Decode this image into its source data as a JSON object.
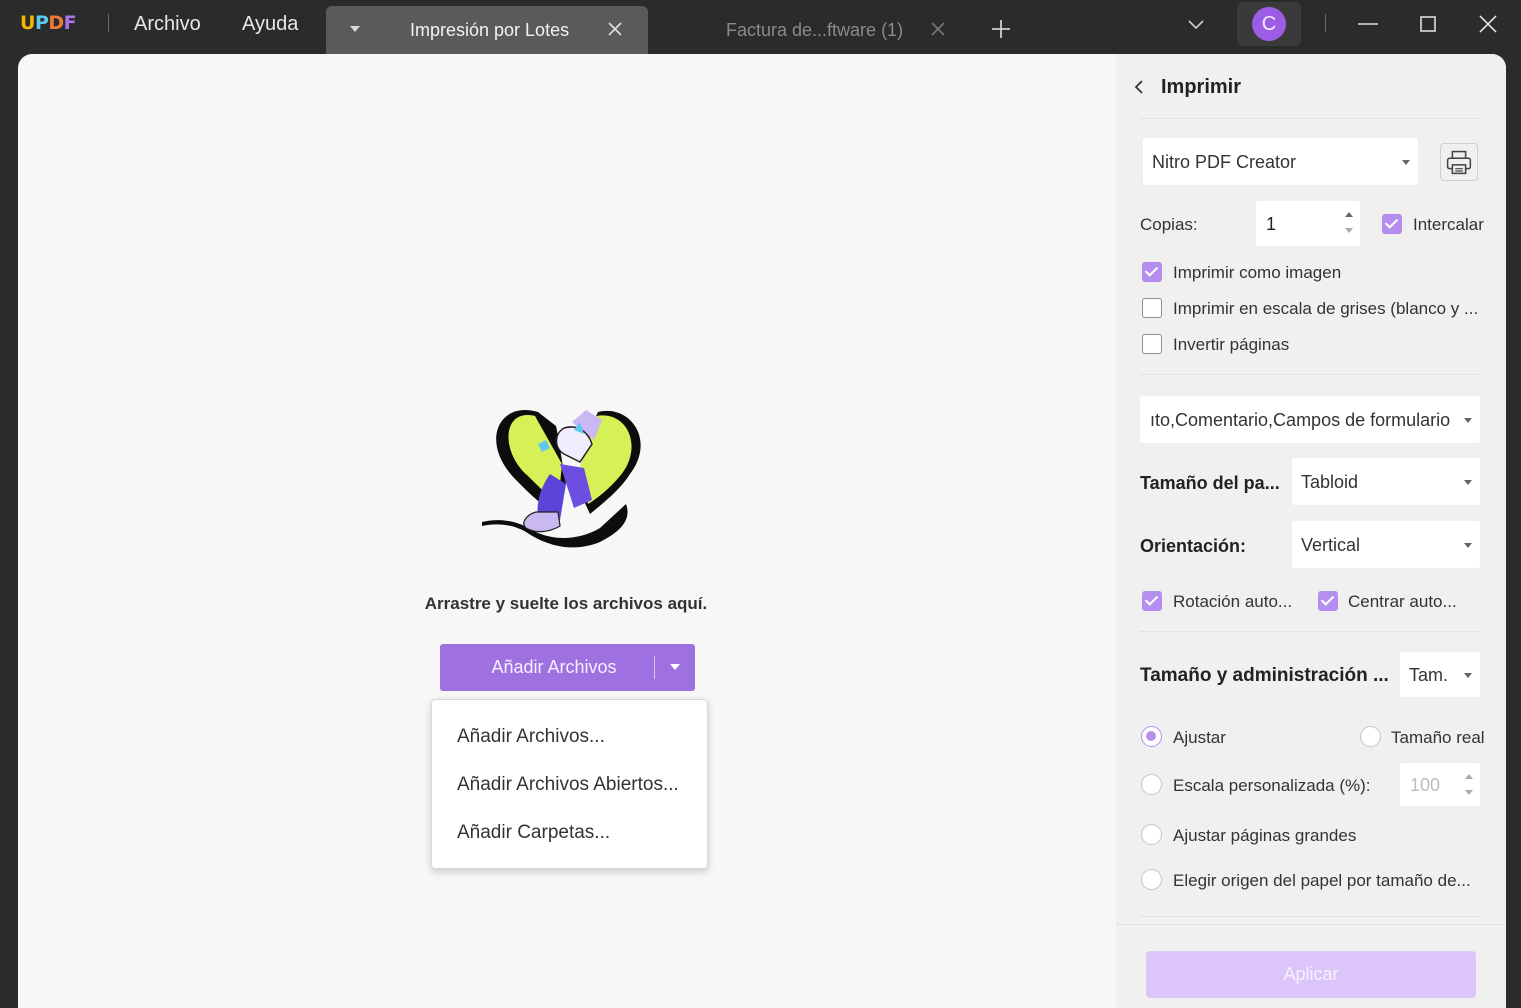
{
  "app": {
    "logo_text": "UPDF",
    "menu": {
      "file": "Archivo",
      "help": "Ayuda"
    },
    "tabs": [
      {
        "label": "Impresión por Lotes",
        "active": true
      },
      {
        "label": "Factura de...ftware (1)",
        "active": false
      }
    ],
    "user_initial": "C",
    "accent_color": "#9f70e0"
  },
  "main": {
    "drop_text": "Arrastre y suelte los archivos aquí.",
    "add_button_label": "Añadir Archivos",
    "dropdown_items": [
      "Añadir Archivos...",
      "Añadir Archivos Abiertos...",
      "Añadir Carpetas..."
    ]
  },
  "panel": {
    "title": "Imprimir",
    "printer": "Nitro PDF Creator",
    "copies_label": "Copias:",
    "copies_value": "1",
    "collate_label": "Intercalar",
    "print_as_image_label": "Imprimir como imagen",
    "grayscale_label": "Imprimir en escala de grises (blanco y ...",
    "reverse_label": "Invertir páginas",
    "content_select": "ıto,Comentario,Campos de formulario",
    "paper_size_label": "Tamaño del pa...",
    "paper_size_value": "Tabloid",
    "orientation_label": "Orientación:",
    "orientation_value": "Vertical",
    "auto_rotate_label": "Rotación auto...",
    "auto_center_label": "Centrar auto...",
    "size_mgmt_label": "Tamaño y administración ...",
    "size_mgmt_value": "Tam.",
    "fit_label": "Ajustar",
    "actual_size_label": "Tamaño real",
    "custom_scale_label": "Escala personalizada (%):",
    "custom_scale_value": "100",
    "shrink_label": "Ajustar páginas grandes",
    "paper_source_label": "Elegir origen del papel por tamaño de...",
    "apply_label": "Aplicar"
  }
}
